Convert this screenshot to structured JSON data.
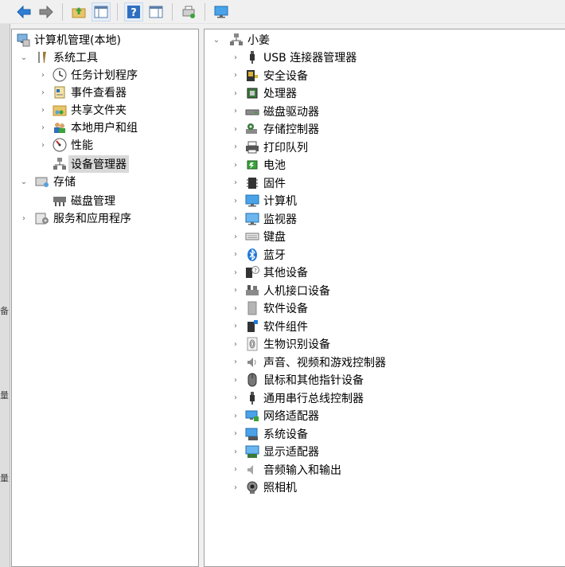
{
  "toolbar": {
    "buttons": [
      {
        "name": "back-button",
        "icon": "arrow-left-icon"
      },
      {
        "name": "forward-button",
        "icon": "arrow-right-icon"
      },
      {
        "name": "up-folder-button",
        "icon": "folder-up-icon"
      },
      {
        "name": "show-hide-tree-button",
        "icon": "console-tree-icon"
      },
      {
        "name": "help-button",
        "icon": "help-icon"
      },
      {
        "name": "action-pane-button",
        "icon": "action-pane-icon"
      },
      {
        "name": "printer-refresh-button",
        "icon": "device-scan-icon"
      },
      {
        "name": "display-devices-button",
        "icon": "monitor-icon"
      }
    ]
  },
  "side_strip": [
    "备",
    "量",
    "量"
  ],
  "tree": {
    "root": "计算机管理(本地)",
    "system_tools": "系统工具",
    "task_scheduler": "任务计划程序",
    "event_viewer": "事件查看器",
    "shared_folders": "共享文件夹",
    "local_users": "本地用户和组",
    "performance": "性能",
    "device_manager": "设备管理器",
    "storage": "存储",
    "disk_management": "磁盘管理",
    "services_apps": "服务和应用程序"
  },
  "devices": {
    "computer_name": "小姜",
    "categories": [
      "USB 连接器管理器",
      "安全设备",
      "处理器",
      "磁盘驱动器",
      "存储控制器",
      "打印队列",
      "电池",
      "固件",
      "计算机",
      "监视器",
      "键盘",
      "蓝牙",
      "其他设备",
      "人机接口设备",
      "软件设备",
      "软件组件",
      "生物识别设备",
      "声音、视频和游戏控制器",
      "鼠标和其他指针设备",
      "通用串行总线控制器",
      "网络适配器",
      "系统设备",
      "显示适配器",
      "音频输入和输出",
      "照相机"
    ]
  },
  "colors": {
    "selection": "#d9d9d9",
    "toolbar_blue": "#2f7fd3",
    "chevron": "#6b6b6b"
  }
}
